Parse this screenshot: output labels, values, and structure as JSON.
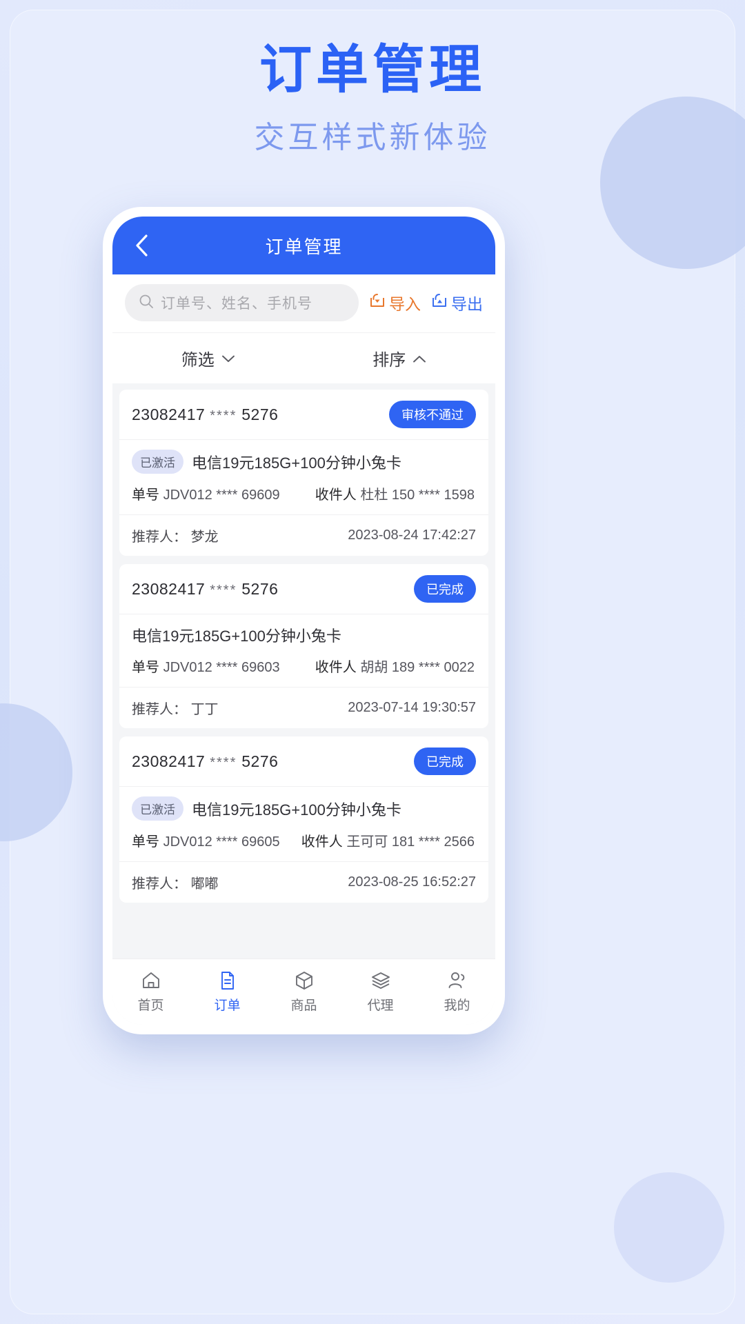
{
  "poster": {
    "title": "订单管理",
    "subtitle": "交互样式新体验",
    "title_color": "#2b62f5",
    "subtitle_color": "#7d99ee",
    "background_color": "#e7edfd"
  },
  "app": {
    "header": {
      "title": "订单管理",
      "back_icon": "chevron-left-icon",
      "accent_color": "#2f64f3"
    },
    "search": {
      "icon": "search-icon",
      "placeholder": "订单号、姓名、手机号",
      "value": ""
    },
    "actions": {
      "import": {
        "label": "导入",
        "icon": "import-tray-icon",
        "color": "#e8772c"
      },
      "export": {
        "label": "导出",
        "icon": "export-tray-icon",
        "color": "#3b6ff0"
      }
    },
    "toolbar": {
      "filter": {
        "label": "筛选",
        "icon": "chevron-down-icon"
      },
      "sort": {
        "label": "排序",
        "icon": "chevron-up-icon"
      }
    },
    "labels": {
      "order_field": "单号",
      "receiver_field": "收件人",
      "referrer_field": "推荐人："
    },
    "orders": [
      {
        "order_no": "23082417",
        "order_mask": "****",
        "order_tail": "5276",
        "status": "审核不通过",
        "activation_tag": "已激活",
        "product": "电信19元185G+100分钟小兔卡",
        "tracking": "JDV012 **** 69609",
        "receiver": "杜杜 150 **** 1598",
        "referrer": "梦龙",
        "time": "2023-08-24 17:42:27"
      },
      {
        "order_no": "23082417",
        "order_mask": "****",
        "order_tail": "5276",
        "status": "已完成",
        "activation_tag": "",
        "product": "电信19元185G+100分钟小兔卡",
        "tracking": "JDV012 **** 69603",
        "receiver": "胡胡 189 **** 0022",
        "referrer": "丁丁",
        "time": "2023-07-14 19:30:57"
      },
      {
        "order_no": "23082417",
        "order_mask": "****",
        "order_tail": "5276",
        "status": "已完成",
        "activation_tag": "已激活",
        "product": "电信19元185G+100分钟小兔卡",
        "tracking": "JDV012 **** 69605",
        "receiver": "王可可 181 **** 2566",
        "referrer": "嘟嘟",
        "time": "2023-08-25 16:52:27"
      }
    ],
    "tabbar": {
      "active_index": 1,
      "items": [
        {
          "label": "首页",
          "icon": "home-icon"
        },
        {
          "label": "订单",
          "icon": "document-icon"
        },
        {
          "label": "商品",
          "icon": "box-icon"
        },
        {
          "label": "代理",
          "icon": "layers-icon"
        },
        {
          "label": "我的",
          "icon": "people-icon"
        }
      ]
    }
  }
}
